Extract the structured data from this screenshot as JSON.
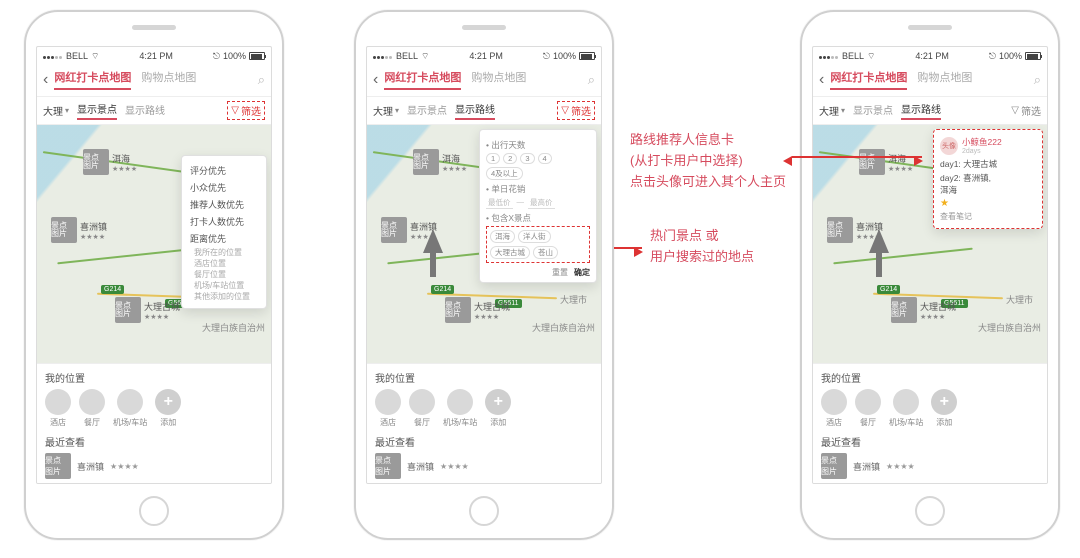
{
  "statusbar": {
    "carrier": "BELL",
    "time": "4:21 PM",
    "battery": "100%"
  },
  "header": {
    "tabs": [
      {
        "label": "网红打卡点地图",
        "active": true
      },
      {
        "label": "购物点地图",
        "active": false
      }
    ]
  },
  "filterRow": {
    "location": "大理",
    "showSpots": "显示景点",
    "showRoute": "显示路线",
    "filter": "筛选"
  },
  "map": {
    "thumbLabel": "景点\n图片",
    "pois": [
      {
        "name": "洱海",
        "stars": "★★★★"
      },
      {
        "name": "喜洲镇",
        "stars": "★★★★"
      },
      {
        "name": "大理古城",
        "stars": "★★★★"
      }
    ],
    "cityLabels": [
      "大理市",
      "大理白族自治州"
    ],
    "hwy": [
      "G214",
      "G5611"
    ]
  },
  "sortPopover": {
    "items": [
      "评分优先",
      "小众优先",
      "推荐人数优先",
      "打卡人数优先",
      "距离优先"
    ],
    "sub": [
      "我所在的位置",
      "酒店位置",
      "餐厅位置",
      "机场/车站位置",
      "其他添加的位置"
    ]
  },
  "filterPopover": {
    "secDays": "出行天数",
    "dayChips": [
      "1",
      "2",
      "3",
      "4",
      "4及以上"
    ],
    "secCost": "单日花销",
    "costMin": "最低价",
    "costMax": "最高价",
    "secInclude": "包含X景点",
    "spotChips": [
      "洱海",
      "洋人街",
      "大理古城",
      "苍山"
    ],
    "reset": "重置",
    "confirm": "确定"
  },
  "userCard": {
    "avatarTag": "头像",
    "name": "小鲸鱼222",
    "sub": "2days",
    "days": [
      {
        "k": "day1:",
        "v": "大理古城"
      },
      {
        "k": "day2:",
        "v": "喜洲镇,\n洱海"
      }
    ],
    "star": "★",
    "view": "查看笔记"
  },
  "sheet": {
    "myLoc": "我的位置",
    "cats": [
      "酒店",
      "餐厅",
      "机场/车站",
      "添加"
    ],
    "recent": "最近查看",
    "recentItem": {
      "name": "喜洲镇",
      "stars": "★★★★"
    }
  },
  "annotations": {
    "a1_line1": "热门景点 或",
    "a1_line2": "用户搜索过的地点",
    "a2_line1": "路线推荐人信息卡",
    "a2_line2": "(从打卡用户中选择)",
    "a2_line3": "点击头像可进入其个人主页"
  }
}
